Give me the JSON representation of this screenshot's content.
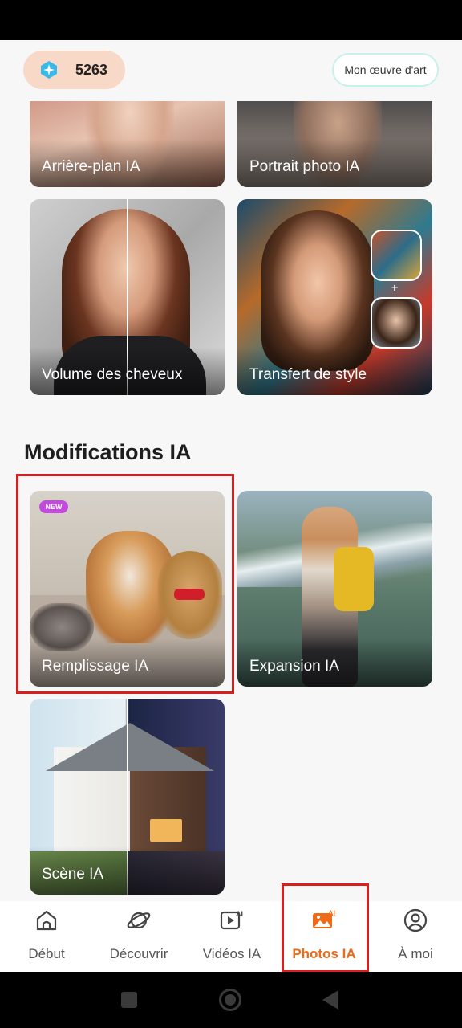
{
  "header": {
    "credits": "5263",
    "artwork_button": "Mon œuvre d'art"
  },
  "cards_top": [
    {
      "label": "Arrière-plan IA"
    },
    {
      "label": "Portrait photo IA"
    },
    {
      "label": "Volume des cheveux"
    },
    {
      "label": "Transfert de style"
    }
  ],
  "section": {
    "title": "Modifications IA"
  },
  "cards_edit": [
    {
      "label": "Remplissage IA",
      "badge": "NEW"
    },
    {
      "label": "Expansion IA"
    },
    {
      "label": "Scène IA"
    }
  ],
  "nav": [
    {
      "label": "Début",
      "icon": "home-icon"
    },
    {
      "label": "Découvrir",
      "icon": "planet-icon"
    },
    {
      "label": "Vidéos IA",
      "icon": "video-ai-icon"
    },
    {
      "label": "Photos IA",
      "icon": "photo-ai-icon",
      "active": true
    },
    {
      "label": "À moi",
      "icon": "user-icon"
    }
  ],
  "colors": {
    "accent": "#ee6a16",
    "highlight": "#d91e1e",
    "badge": "#c24bde"
  }
}
